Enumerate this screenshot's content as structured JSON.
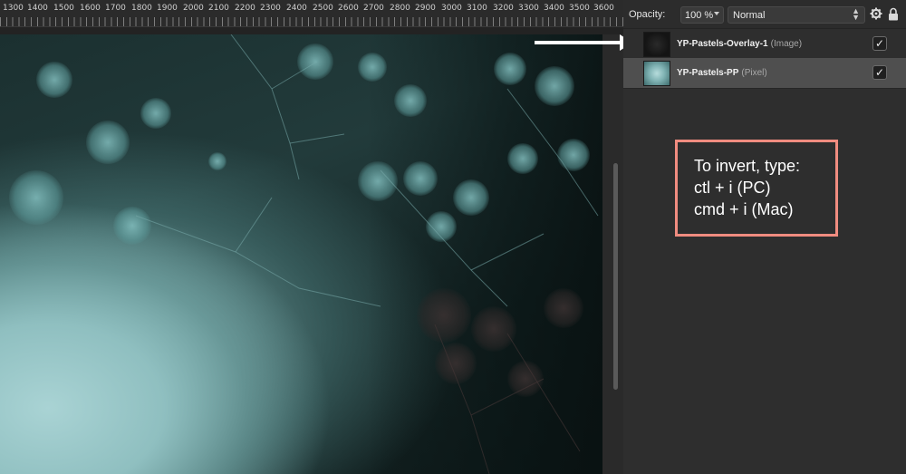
{
  "ruler": {
    "labels": [
      "1300",
      "1400",
      "1500",
      "1600",
      "1700",
      "1800",
      "1900",
      "2000",
      "2100",
      "2200",
      "2300",
      "2400",
      "2500",
      "2600",
      "2700",
      "2800",
      "2900",
      "3000",
      "3100",
      "3200",
      "3300",
      "3400",
      "3500",
      "3600"
    ]
  },
  "toolbar": {
    "opacity_label": "Opacity:",
    "opacity_value": "100 %",
    "blend_mode": "Normal",
    "settings_icon": "gear-icon",
    "lock_icon": "lock-icon"
  },
  "layers": [
    {
      "name": "YP-Pastels-Overlay-1",
      "type": "(Image)",
      "visible": "✓"
    },
    {
      "name": "YP-Pastels-PP",
      "type": "(Pixel)",
      "visible": "✓"
    }
  ],
  "tip": {
    "lines": [
      "To invert, type:",
      "ctl + i (PC)",
      "cmd + i (Mac)"
    ],
    "border_color": "#f08c80"
  },
  "annotation": {
    "arrow_icon": "right-arrow-icon",
    "color": "#ffffff"
  }
}
